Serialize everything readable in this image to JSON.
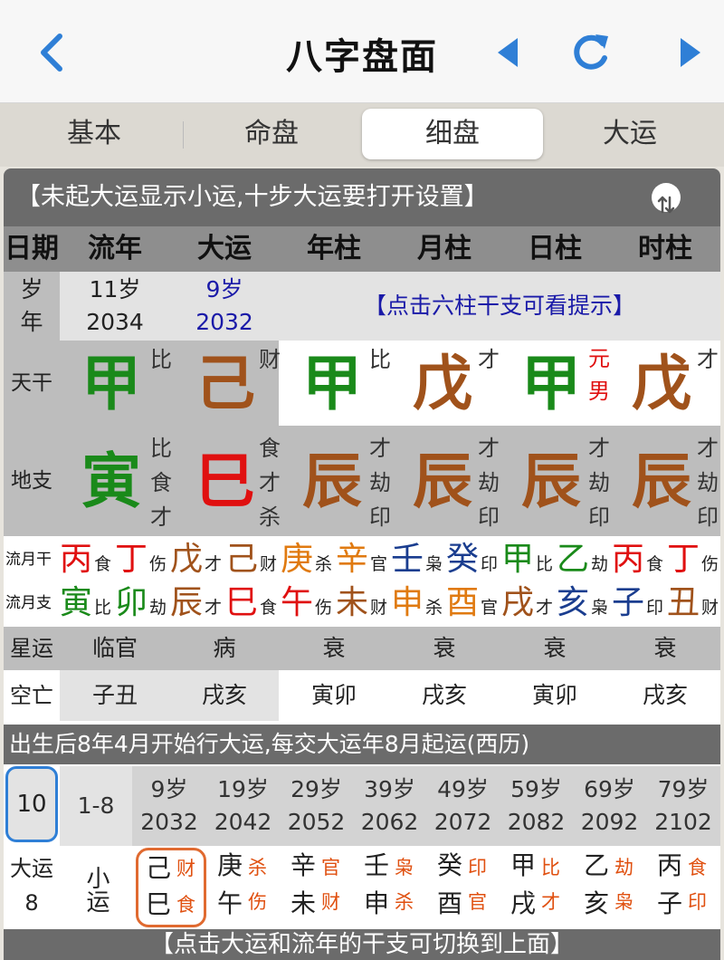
{
  "nav": {
    "title": "八字盘面",
    "back": "chevron-left-icon",
    "prev": "triangle-left-icon",
    "refresh": "refresh-icon",
    "next": "triangle-right-icon",
    "accent": "#2f7fd6"
  },
  "tabs": [
    "基本",
    "命盘",
    "细盘",
    "大运"
  ],
  "active_tab": "细盘",
  "notice": "【未起大运显示小运,十步大运要打开设置】",
  "columns": [
    "日期",
    "流年",
    "大运",
    "年柱",
    "月柱",
    "日柱",
    "时柱"
  ],
  "age_row": {
    "label1": "岁",
    "label2": "年",
    "liunian_age": "11岁",
    "liunian_year": "2034",
    "dayun_age": "9岁",
    "dayun_year": "2032",
    "hint": "【点击六柱干支可看提示】"
  },
  "tiangan": {
    "label": "天干",
    "items": [
      {
        "char": "甲",
        "god": "比"
      },
      {
        "char": "己",
        "god": "财"
      },
      {
        "char": "甲",
        "god": "比"
      },
      {
        "char": "戊",
        "god": "才"
      },
      {
        "char": "甲",
        "god": "元男"
      },
      {
        "char": "戊",
        "god": "才"
      }
    ]
  },
  "dizhi": {
    "label": "地支",
    "items": [
      {
        "char": "寅",
        "gods": [
          "比",
          "食",
          "才"
        ]
      },
      {
        "char": "巳",
        "gods": [
          "食",
          "才",
          "杀"
        ]
      },
      {
        "char": "辰",
        "gods": [
          "才",
          "劫",
          "印"
        ]
      },
      {
        "char": "辰",
        "gods": [
          "才",
          "劫",
          "印"
        ]
      },
      {
        "char": "辰",
        "gods": [
          "才",
          "劫",
          "印"
        ]
      },
      {
        "char": "辰",
        "gods": [
          "才",
          "劫",
          "印"
        ]
      }
    ]
  },
  "liuyue_gan": {
    "label": "流月干",
    "items": [
      [
        "丙",
        "食"
      ],
      [
        "丁",
        "伤"
      ],
      [
        "戊",
        "才"
      ],
      [
        "己",
        "财"
      ],
      [
        "庚",
        "杀"
      ],
      [
        "辛",
        "官"
      ],
      [
        "壬",
        "枭"
      ],
      [
        "癸",
        "印"
      ],
      [
        "甲",
        "比"
      ],
      [
        "乙",
        "劫"
      ],
      [
        "丙",
        "食"
      ],
      [
        "丁",
        "伤"
      ]
    ]
  },
  "liuyue_zhi": {
    "label": "流月支",
    "items": [
      [
        "寅",
        "比"
      ],
      [
        "卯",
        "劫"
      ],
      [
        "辰",
        "才"
      ],
      [
        "巳",
        "食"
      ],
      [
        "午",
        "伤"
      ],
      [
        "未",
        "财"
      ],
      [
        "申",
        "杀"
      ],
      [
        "酉",
        "官"
      ],
      [
        "戌",
        "才"
      ],
      [
        "亥",
        "枭"
      ],
      [
        "子",
        "印"
      ],
      [
        "丑",
        "财"
      ]
    ]
  },
  "xingyun": {
    "label": "星运",
    "items": [
      "临官",
      "病",
      "衰",
      "衰",
      "衰",
      "衰"
    ]
  },
  "kongwang": {
    "label": "空亡",
    "items": [
      "子丑",
      "戌亥",
      "寅卯",
      "戌亥",
      "寅卯",
      "戌亥"
    ]
  },
  "dayun_note": "出生后8年4月开始行大运,每交大运年8月起运(西历)",
  "dayun": {
    "current": "10",
    "label": "大运",
    "label_num": "8",
    "xiaoyun": "小运",
    "xiaoyun_range": "1-8",
    "steps": [
      {
        "age": "9岁",
        "year": "2032",
        "gan": "己",
        "gs": "财",
        "zhi": "巳",
        "zs": "食"
      },
      {
        "age": "19岁",
        "year": "2042",
        "gan": "庚",
        "gs": "杀",
        "zhi": "午",
        "zs": "伤"
      },
      {
        "age": "29岁",
        "year": "2052",
        "gan": "辛",
        "gs": "官",
        "zhi": "未",
        "zs": "财"
      },
      {
        "age": "39岁",
        "year": "2062",
        "gan": "壬",
        "gs": "枭",
        "zhi": "申",
        "zs": "杀"
      },
      {
        "age": "49岁",
        "year": "2072",
        "gan": "癸",
        "gs": "印",
        "zhi": "酉",
        "zs": "官"
      },
      {
        "age": "59岁",
        "year": "2082",
        "gan": "甲",
        "gs": "比",
        "zhi": "戌",
        "zs": "才"
      },
      {
        "age": "69岁",
        "year": "2092",
        "gan": "乙",
        "gs": "劫",
        "zhi": "亥",
        "zs": "枭"
      },
      {
        "age": "79岁",
        "year": "2102",
        "gan": "丙",
        "gs": "食",
        "zhi": "子",
        "zs": "印"
      }
    ]
  },
  "footer": "【点击大运和流年的干支可切换到上面】"
}
